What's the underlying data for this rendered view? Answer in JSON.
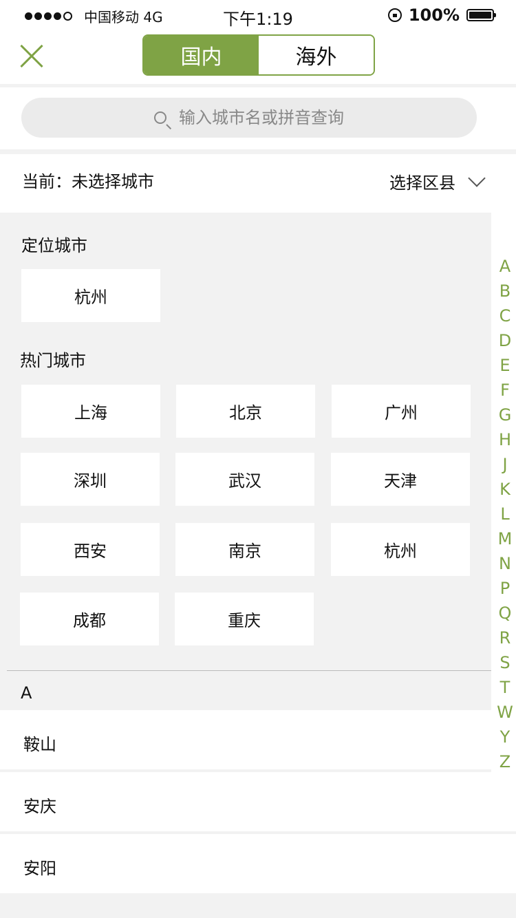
{
  "status_bar": {
    "carrier": "中国移动 4G",
    "time": "下午1:19",
    "battery": "100%"
  },
  "nav": {
    "tabs": [
      {
        "label": "国内",
        "active": true
      },
      {
        "label": "海外",
        "active": false
      }
    ]
  },
  "search": {
    "placeholder": "输入城市名或拼音查询"
  },
  "current": {
    "label": "当前：未选择城市",
    "district_label": "选择区县"
  },
  "location": {
    "title": "定位城市",
    "city": "杭州"
  },
  "hot": {
    "title": "热门城市",
    "cities": [
      "上海",
      "北京",
      "广州",
      "深圳",
      "武汉",
      "天津",
      "西安",
      "南京",
      "杭州",
      "成都",
      "重庆"
    ]
  },
  "list": {
    "letter": "A",
    "items": [
      "鞍山",
      "安庆",
      "安阳"
    ]
  },
  "index_letters": [
    "A",
    "B",
    "C",
    "D",
    "E",
    "F",
    "G",
    "H",
    "J",
    "K",
    "L",
    "M",
    "N",
    "P",
    "Q",
    "R",
    "S",
    "T",
    "W",
    "Y",
    "Z"
  ],
  "colors": {
    "accent": "#7fa345",
    "background": "#f2f2f2"
  }
}
